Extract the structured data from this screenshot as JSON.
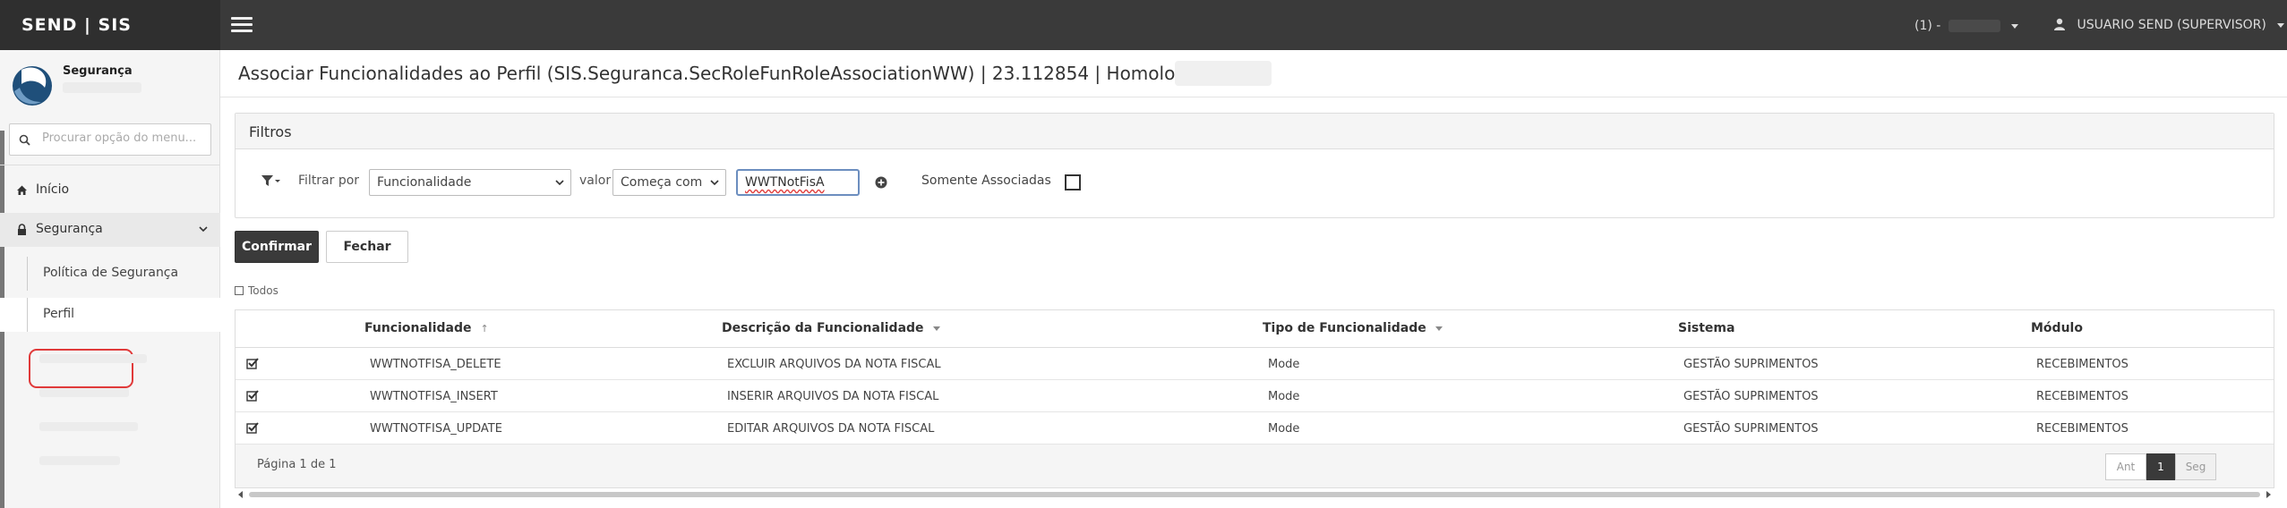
{
  "topbar": {
    "brand": "SEND | SIS",
    "env_label": "(1) -",
    "user_label": "USUARIO SEND (SUPERVISOR)"
  },
  "sidebar": {
    "app_title": "Segurança",
    "search_placeholder": "Procurar opção do menu...",
    "items": [
      {
        "label": "Início",
        "icon": "home-icon"
      },
      {
        "label": "Segurança",
        "icon": "lock-icon"
      }
    ],
    "subitems": [
      {
        "label": "Política de Segurança"
      },
      {
        "label": "Perfil"
      }
    ]
  },
  "page": {
    "title": "Associar Funcionalidades ao Perfil (SIS.Seguranca.SecRoleFunRoleAssociationWW) | 23.112854 | Homologação |"
  },
  "filters": {
    "panel_title": "Filtros",
    "filter_by_label": "Filtrar por",
    "filter_field": "Funcionalidade",
    "value_label": "valor",
    "operator": "Começa com",
    "value": "WWTNotFisA",
    "only_associated_label": "Somente Associadas"
  },
  "actions": {
    "confirm": "Confirmar",
    "close": "Fechar",
    "select_all": "Todos"
  },
  "grid": {
    "columns": [
      "Funcionalidade",
      "Descrição da Funcionalidade",
      "Tipo de Funcionalidade",
      "Sistema",
      "Módulo"
    ],
    "sort_indicator": "↑",
    "rows": [
      {
        "checked": true,
        "cells": [
          "WWTNOTFISA_DELETE",
          "EXCLUIR ARQUIVOS DA NOTA FISCAL",
          "Mode",
          "GESTÃO SUPRIMENTOS",
          "RECEBIMENTOS"
        ]
      },
      {
        "checked": true,
        "cells": [
          "WWTNOTFISA_INSERT",
          "INSERIR ARQUIVOS DA NOTA FISCAL",
          "Mode",
          "GESTÃO SUPRIMENTOS",
          "RECEBIMENTOS"
        ]
      },
      {
        "checked": true,
        "cells": [
          "WWTNOTFISA_UPDATE",
          "EDITAR ARQUIVOS DA NOTA FISCAL",
          "Mode",
          "GESTÃO SUPRIMENTOS",
          "RECEBIMENTOS"
        ]
      }
    ],
    "pagination": {
      "summary": "Página 1 de 1",
      "prev": "Ant",
      "current": "1",
      "next": "Seg"
    }
  }
}
